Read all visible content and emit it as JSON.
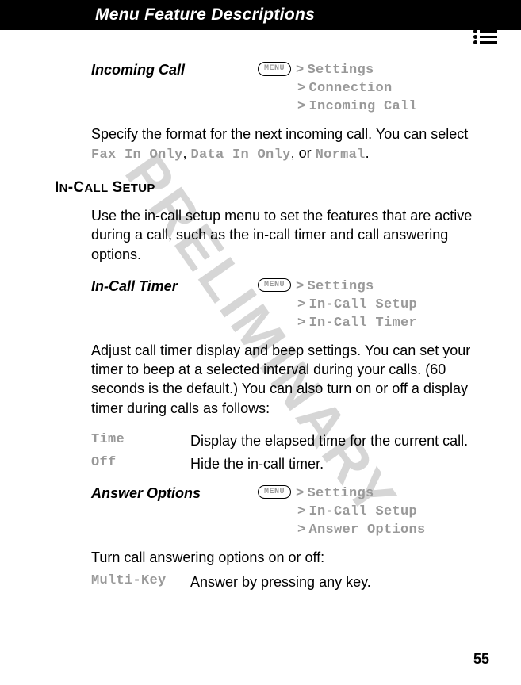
{
  "watermark": "PRELIMINARY",
  "header": {
    "title": "Menu Feature Descriptions"
  },
  "page_number": "55",
  "menu_button_label": "MENU",
  "sections": {
    "incoming_call": {
      "title": "Incoming Call",
      "path": {
        "l1": "Settings",
        "l2": "Connection",
        "l3": "Incoming Call"
      },
      "body_pre": "Specify the format for the next incoming call. You can select ",
      "opt1": "Fax In Only",
      "sep1": ", ",
      "opt2": "Data In Only",
      "sep2": ", or ",
      "opt3": "Normal",
      "period": "."
    },
    "in_call_setup_heading": "In-Call Setup",
    "in_call_timer": {
      "title": "In-Call Timer",
      "path": {
        "l1": "Settings",
        "l2": "In-Call Setup",
        "l3": "In-Call Timer"
      },
      "body": "Adjust call timer display and beep settings. You can set your timer to beep at a selected interval during your calls. (60 seconds is the default.) You can also turn on or off a display timer during calls as follows:",
      "options": {
        "time": {
          "label": "Time",
          "desc": "Display the elapsed time for the current call."
        },
        "off": {
          "label": "Off",
          "desc": "Hide the in-call timer."
        }
      }
    },
    "answer_options": {
      "title": "Answer Options",
      "path": {
        "l1": "Settings",
        "l2": "In-Call Setup",
        "l3": "Answer Options"
      },
      "body": "Turn call answering options on or off:",
      "options": {
        "multikey": {
          "label": "Multi-Key",
          "desc": "Answer by pressing any key."
        }
      }
    }
  }
}
